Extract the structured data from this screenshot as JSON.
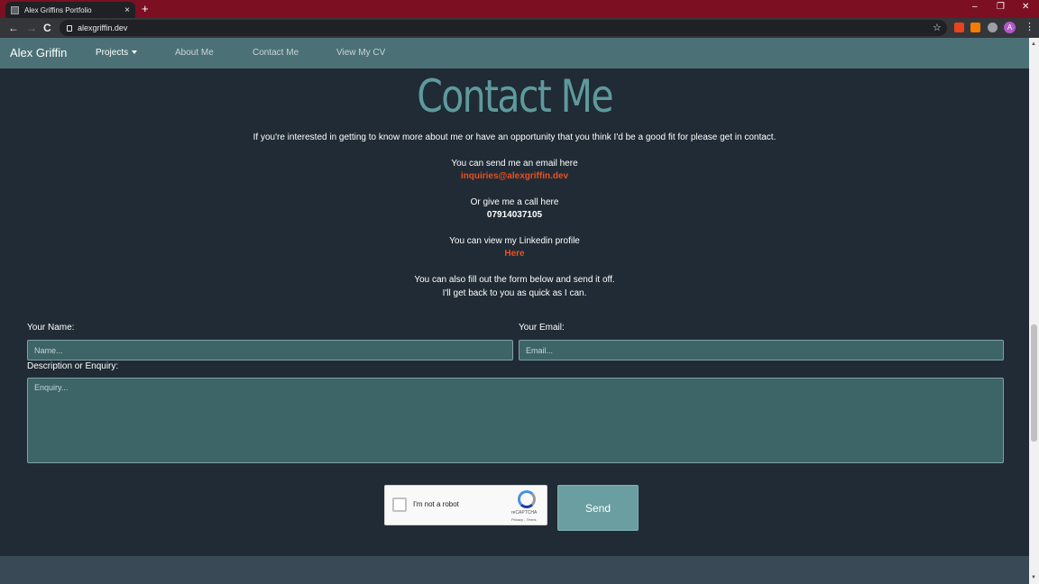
{
  "browser": {
    "tab_title": "Alex Griffins Portfolio",
    "tab_close": "×",
    "new_tab": "+",
    "url": "alexgriffin.dev",
    "back": "←",
    "forward": "→",
    "reload": "C",
    "star": "☆",
    "profile_initial": "A",
    "menu": "⋮",
    "minimize": "–",
    "restore": "❐",
    "close": "✕"
  },
  "nav": {
    "brand": "Alex Griffin",
    "items": [
      {
        "label": "Projects"
      },
      {
        "label": "About Me"
      },
      {
        "label": "Contact Me"
      },
      {
        "label": "View My CV"
      }
    ]
  },
  "contact": {
    "heading": "Contact Me",
    "intro": "If you're interested in getting to know more about me or have an opportunity that you think I'd be a good fit for please get in contact.",
    "email_prompt": "You can send me an email here",
    "email": "inquiries@alexgriffin.dev",
    "phone_prompt": "Or give me a call here",
    "phone": "07914037105",
    "linkedin_prompt": "You can view my Linkedin profile",
    "linkedin_link": "Here",
    "form_note_1": "You can also fill out the form below and send it off.",
    "form_note_2": "I'll get back to you as quick as I can."
  },
  "form": {
    "name_label": "Your Name:",
    "name_placeholder": "Name...",
    "email_label": "Your Email:",
    "email_placeholder": "Email...",
    "enquiry_label": "Description or Enquiry:",
    "enquiry_placeholder": "Enquiry...",
    "captcha_label": "I'm not a robot",
    "captcha_brand": "reCAPTCHA",
    "captcha_terms": "Privacy - Terms",
    "send_label": "Send"
  },
  "colors": {
    "accent": "#e9501f",
    "nav_bg": "#4b7176",
    "heading": "#5e9a9c",
    "page_bg": "#202b35"
  }
}
